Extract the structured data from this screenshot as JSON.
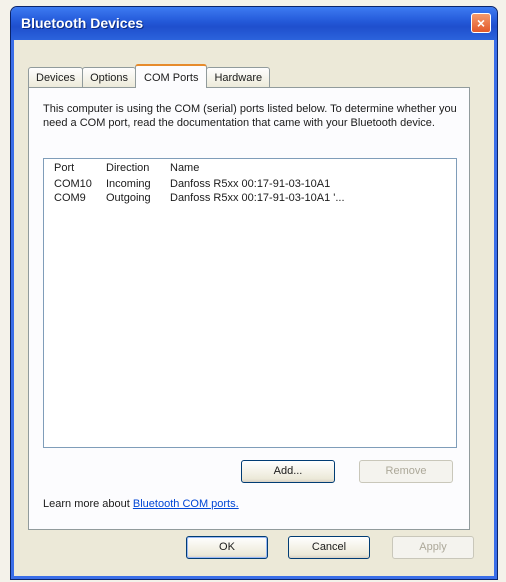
{
  "window": {
    "title": "Bluetooth Devices",
    "close_glyph": "×"
  },
  "tabs": [
    {
      "label": "Devices"
    },
    {
      "label": "Options"
    },
    {
      "label": "COM Ports",
      "active": true
    },
    {
      "label": "Hardware"
    }
  ],
  "panel": {
    "intro": "This computer is using the COM (serial) ports listed below. To determine whether you need a COM port, read the documentation that came with your Bluetooth device.",
    "list": {
      "headers": {
        "port": "Port",
        "direction": "Direction",
        "name": "Name"
      },
      "rows": [
        {
          "port": "COM10",
          "direction": "Incoming",
          "name": "Danfoss R5xx 00:17-91-03-10A1"
        },
        {
          "port": "COM9",
          "direction": "Outgoing",
          "name": "Danfoss R5xx 00:17-91-03-10A1 '..."
        }
      ]
    },
    "add_label": "Add...",
    "remove_label": "Remove",
    "learn_prefix": "Learn more about",
    "learn_link": "Bluetooth COM ports."
  },
  "footer": {
    "ok_label": "OK",
    "cancel_label": "Cancel",
    "apply_label": "Apply"
  },
  "colors": {
    "titlebar": "#2358d8",
    "active_tab_accent": "#e68b2c",
    "link": "#0046d5"
  }
}
